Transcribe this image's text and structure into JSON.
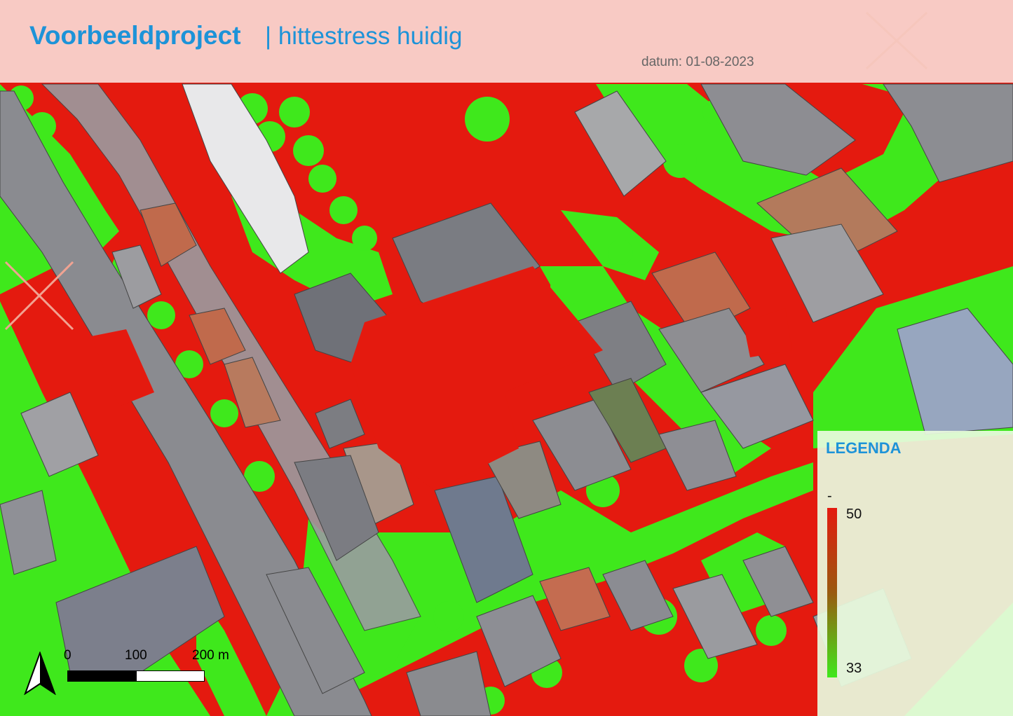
{
  "header": {
    "title": "Voorbeeldproject",
    "subtitle": "| hittestress huidig",
    "date": "datum: 01-08-2023"
  },
  "legend": {
    "title": "LEGENDA",
    "unit": "-",
    "max_label": "50",
    "min_label": "33",
    "max_value": 50,
    "min_value": 33,
    "color_max": "#e41a0f",
    "color_mid": "#9a5a10",
    "color_min": "#3fe81c"
  },
  "scalebar": {
    "labels": [
      "0",
      "100",
      "200 m"
    ]
  },
  "map": {
    "icons": [
      "north-arrow-icon",
      "close-x-icon"
    ],
    "colors": {
      "hot": "#e41a0f",
      "cool": "#3fe81c",
      "building": "#8e8e92"
    }
  }
}
